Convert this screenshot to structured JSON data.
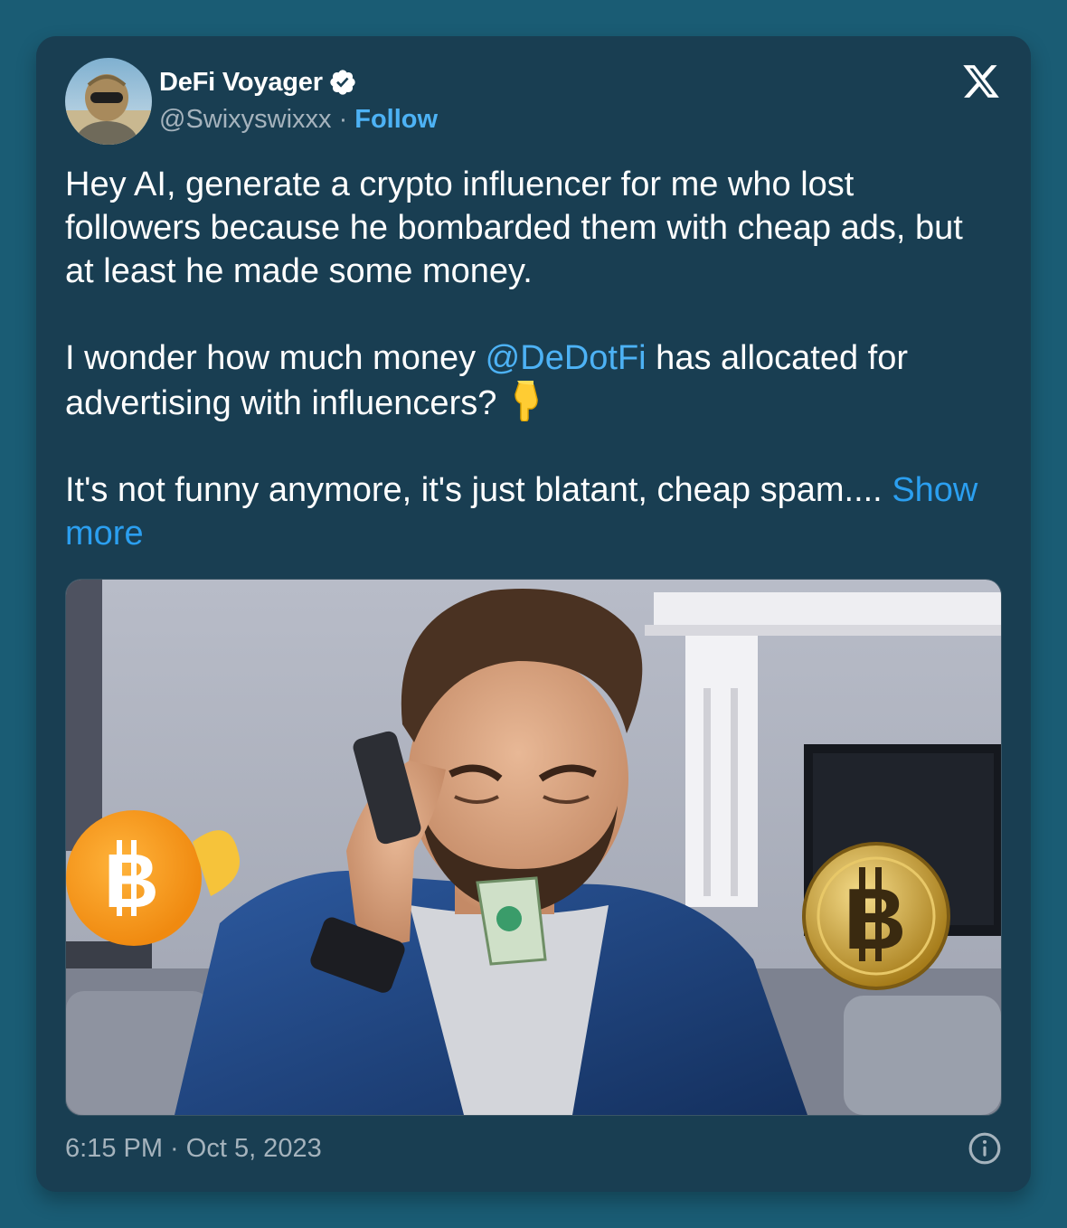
{
  "author": {
    "display_name": "DeFi Voyager",
    "handle": "@Swixyswixxx",
    "separator": "·",
    "follow_label": "Follow",
    "verified": true
  },
  "icons": {
    "verified": "verified-badge-icon",
    "brand": "x-logo-icon",
    "info": "info-icon",
    "emoji": "backhand-index-pointing-down-icon"
  },
  "tweet": {
    "paragraph1": "Hey AI, generate a crypto influencer for me who lost followers because he bombarded them with cheap ads, but at least he made some money.",
    "paragraph2_before": "I wonder how much money ",
    "paragraph2_mention": "@DeDotFi",
    "paragraph2_after": " has allocated for advertising with influencers? ",
    "paragraph3": "It's not funny anymore, it's just blatant, cheap spam.... ",
    "show_more": "Show more"
  },
  "footer": {
    "timestamp": "6:15 PM · Oct 5, 2023"
  },
  "colors": {
    "page_bg": "#1a5c74",
    "card_bg": "#193e52",
    "link": "#4db2f5",
    "verified_badge": "#ffffff",
    "secondary_text": "#a5b3bd"
  }
}
